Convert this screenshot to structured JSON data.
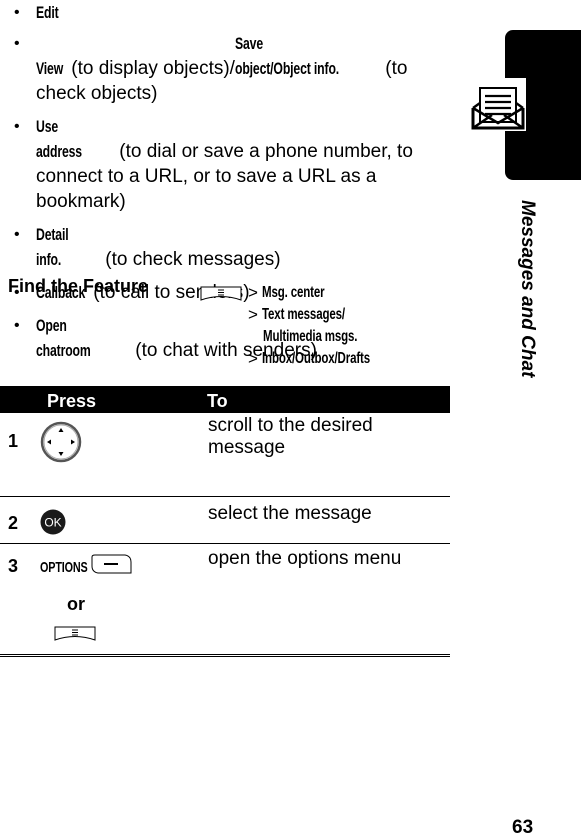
{
  "bullets": [
    {
      "keyword": "Edit",
      "text": ""
    },
    {
      "keyword": "View",
      "text": " (to display objects)/",
      "keyword2": "Save object/Object info.",
      "text2": " (to check objects)"
    },
    {
      "keyword": "Use address",
      "text": " (to dial or save a phone number, to connect to a URL, or to save a URL as a bookmark)"
    },
    {
      "keyword": "Detail info.",
      "text": " (to check messages)"
    },
    {
      "keyword": "Callback",
      "text": " (to call to senders)"
    },
    {
      "keyword": "Open chatroom",
      "text": " (to chat with senders)"
    }
  ],
  "section_tab": {
    "title": "Messages and Chat",
    "icon": "envelope-letter-icon"
  },
  "find_feature": {
    "label": "Find the Feature",
    "key_icon": "menu-key-icon",
    "path": [
      {
        "sep": ">",
        "item": "Msg. center"
      },
      {
        "sep": ">",
        "item": "Text messages/"
      },
      {
        "sep": "",
        "item": "Multimedia msgs."
      },
      {
        "sep": ">",
        "item": "Inbox/Outbox/Drafts"
      }
    ]
  },
  "steps_table": {
    "headers": {
      "press": "Press",
      "to": "To"
    },
    "rows": [
      {
        "num": "1",
        "press_icon": "navigation-key-icon",
        "to": "scroll to the desired message"
      },
      {
        "num": "2",
        "press_icon": "ok-key-icon",
        "press_label": "OK",
        "to": "select the message"
      },
      {
        "num": "3",
        "press_label": "OPTIONS",
        "press_icon": "left-soft-key-icon",
        "or": "or",
        "alt_icon": "menu-key-icon",
        "to": "open the options menu"
      }
    ]
  },
  "page_number": "63"
}
